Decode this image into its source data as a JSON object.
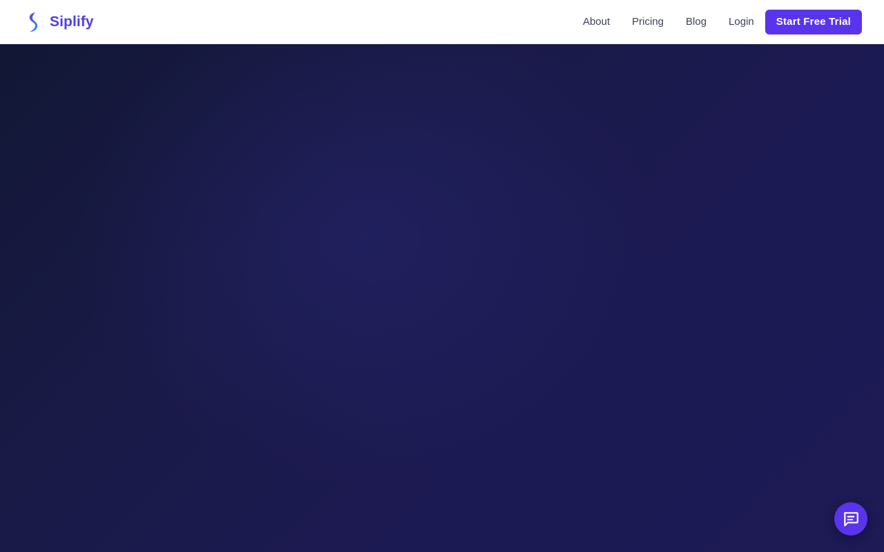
{
  "header": {
    "brand_name": "Siplify",
    "logo_icon": "siplify-s-logo-icon",
    "nav": {
      "about": "About",
      "pricing": "Pricing",
      "blog": "Blog",
      "login": "Login"
    },
    "cta_label": "Start Free Trial"
  },
  "chat_widget": {
    "icon": "chat-bubble-icon"
  },
  "colors": {
    "brand": "#4f3ee8",
    "cta": "#5a34ec",
    "hero_background": "#1c1a52",
    "nav_text": "#3b4157"
  }
}
